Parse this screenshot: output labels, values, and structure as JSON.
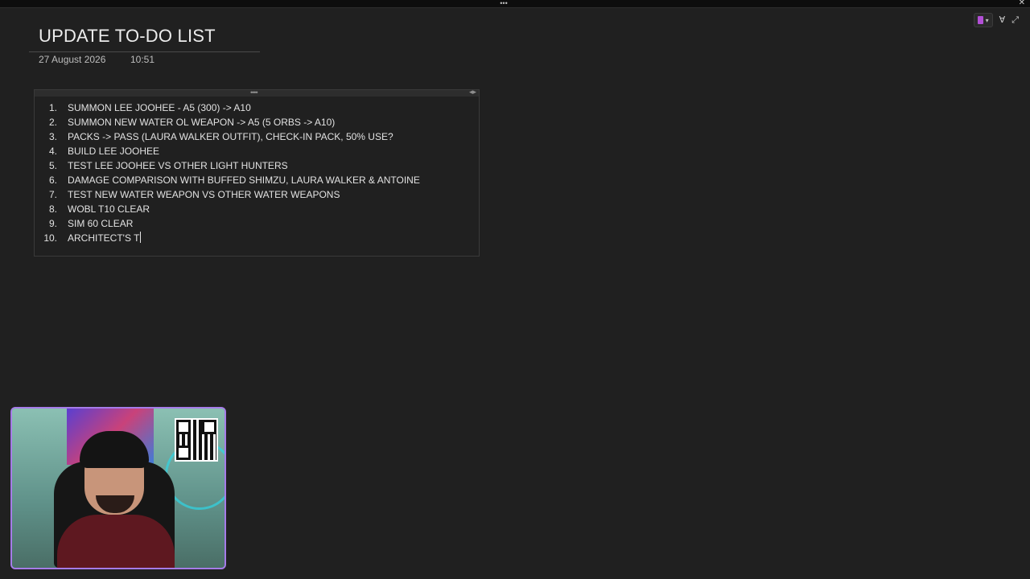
{
  "window": {
    "grip_glyph": "•••",
    "close_glyph": "✕"
  },
  "toolbar": {
    "notebook_color": "#b24fd6",
    "filter_glyph": "∀",
    "expand_glyph": "⤢",
    "dropdown_glyph": "▾"
  },
  "page": {
    "title": "UPDATE TO-DO LIST",
    "date": "27 August 2026",
    "time": "10:51"
  },
  "note": {
    "handle_dots": "••••",
    "handle_arrows": "◂▸",
    "items": [
      {
        "num": "1.",
        "text": "SUMMON LEE JOOHEE - A5 (300) -> A10"
      },
      {
        "num": "2.",
        "text": "SUMMON NEW WATER OL WEAPON -> A5 (5 ORBS -> A10)"
      },
      {
        "num": "3.",
        "text": "PACKS -> PASS (LAURA WALKER OUTFIT), CHECK-IN PACK, 50% USE?"
      },
      {
        "num": "4.",
        "text": "BUILD LEE JOOHEE"
      },
      {
        "num": "5.",
        "text": "TEST LEE JOOHEE VS OTHER LIGHT HUNTERS"
      },
      {
        "num": "6.",
        "text": "DAMAGE COMPARISON WITH BUFFED SHIMZU, LAURA WALKER & ANTOINE"
      },
      {
        "num": "7.",
        "text": "TEST NEW WATER WEAPON VS OTHER WATER WEAPONS"
      },
      {
        "num": "8.",
        "text": "WOBL T10 CLEAR"
      },
      {
        "num": "9.",
        "text": "SIM 60 CLEAR"
      },
      {
        "num": "10.",
        "text": "ARCHITECT'S T"
      }
    ]
  },
  "colors": {
    "background": "#202020",
    "webcam_border": "#a57be8"
  }
}
